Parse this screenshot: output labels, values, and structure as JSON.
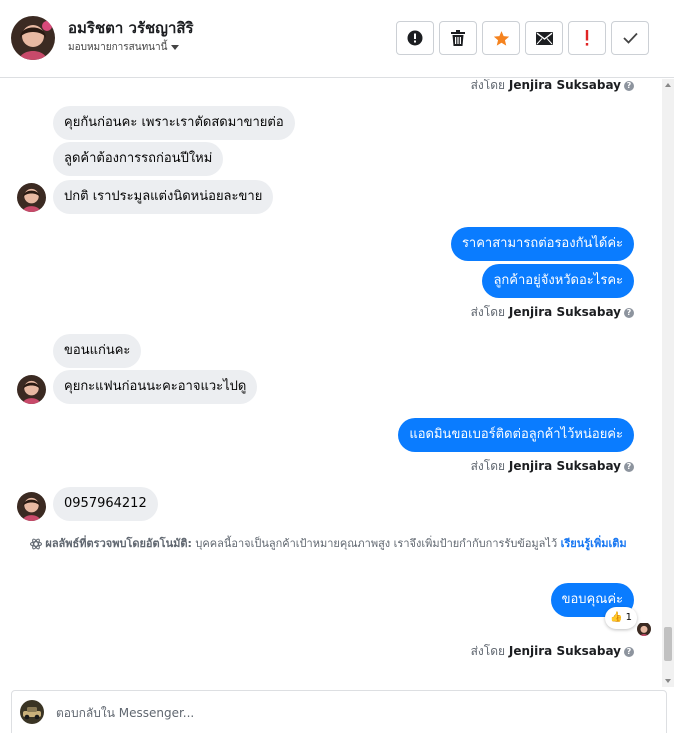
{
  "header": {
    "name": "อมริชตา วรัชญาสิริ",
    "assign_label": "มอบหมายการสนทนานี้"
  },
  "toolbar": {
    "buttons": [
      {
        "icon": "info-icon"
      },
      {
        "icon": "trash-icon"
      },
      {
        "icon": "star-icon",
        "color": "#f5831f"
      },
      {
        "icon": "envelope-icon"
      },
      {
        "icon": "exclamation-icon",
        "color": "#e02424"
      },
      {
        "icon": "check-icon"
      }
    ]
  },
  "colors": {
    "outgoing_bubble": "#0a7cff",
    "incoming_bubble": "#eceef1"
  },
  "chat": {
    "sent_by_prefix": "ส่งโดย",
    "sent_by_name": "Jenjira Suksabay",
    "messages": [
      "คุยกันก่อนคะ เพราะเราตัดสดมาขายต่อ",
      "ลูดค้าต้องการรถก่อนปีใหม่",
      "ปกติ เราประมูลแต่งนิดหน่อยละขาย",
      "ราคาสามารถต่อรองกันได้ค่ะ",
      "ลูกค้าอยู่จังหวัดอะไรคะ",
      "ขอนแก่นคะ",
      "คุยกะแฟนก่อนนะคะอาจแวะไปดู",
      "แอดมินขอเบอร์ติดต่อลูกค้าไว้หน่อยค่ะ",
      "0957964212",
      "ขอบคุณค่ะ"
    ],
    "notice": {
      "title": "ผลลัพธ์ที่ตรวจพบโดยอัตโนมัติ:",
      "text": "บุคคลนี้อาจเป็นลูกค้าเป้าหมายคุณภาพสูง เราจึงเพิ่มป้ายกำกับการรับข้อมูลไว้",
      "link": "เรียนรู้เพิ่มเติม"
    },
    "reaction": {
      "emoji": "👍",
      "count": "1"
    }
  },
  "reply": {
    "placeholder": "ตอบกลับใน Messenger..."
  }
}
